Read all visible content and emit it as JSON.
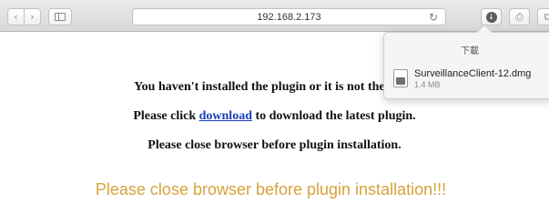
{
  "toolbar": {
    "back_glyph": "‹",
    "forward_glyph": "›",
    "address": "192.168.2.173",
    "reload_glyph": "↻",
    "download_glyph": "↓",
    "share_glyph": "⎙",
    "tabs_glyph": "⧉"
  },
  "page": {
    "line1": "You haven't installed the plugin or it is not the late",
    "line2_before": "Please click ",
    "line2_link": "download",
    "line2_after": " to download the latest plugin.",
    "line3": "Please close browser before plugin installation.",
    "warning": "Please close browser before plugin installation!!!",
    "link_color": "#1a3fb8",
    "warning_color": "#d8a23c"
  },
  "downloads": {
    "title": "下載",
    "items": [
      {
        "name": "SurveillanceClient-12.dmg",
        "size": "1.4 MB",
        "icon": "disk-image-icon"
      }
    ]
  }
}
